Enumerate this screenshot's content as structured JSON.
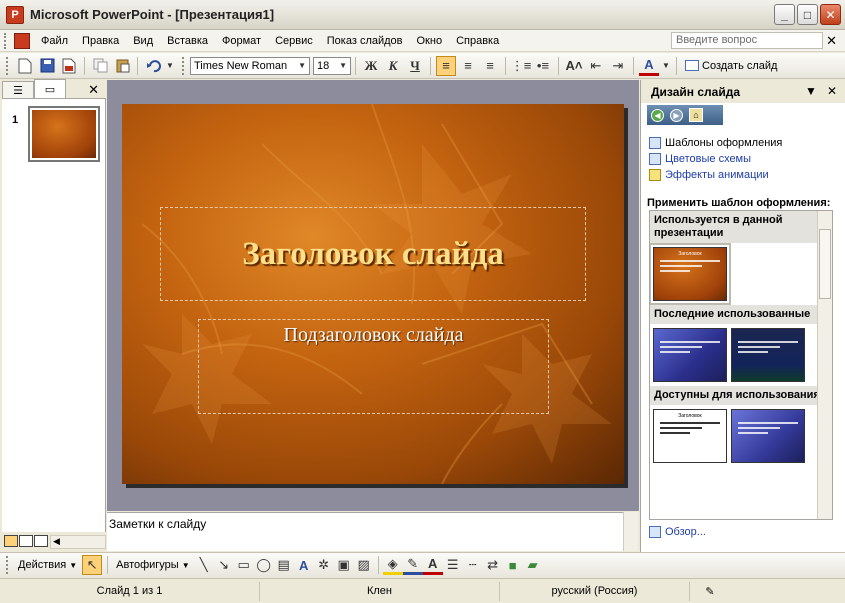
{
  "window": {
    "title": "Microsoft PowerPoint - [Презентация1]",
    "min_glyph": "_",
    "max_glyph": "□",
    "close_glyph": "✕"
  },
  "menu": {
    "items": [
      "Файл",
      "Правка",
      "Вид",
      "Вставка",
      "Формат",
      "Сервис",
      "Показ слайдов",
      "Окно",
      "Справка"
    ],
    "help_placeholder": "Введите вопрос",
    "close_glyph": "✕"
  },
  "toolbar": {
    "font_name": "Times New Roman",
    "font_size": "18",
    "bold": "Ж",
    "italic": "К",
    "underline": "Ч",
    "new_slide": "Создать слайд"
  },
  "left_pane": {
    "slide_number": "1",
    "close_glyph": "✕"
  },
  "slide": {
    "title": "Заголовок слайда",
    "subtitle": "Подзаголовок слайда"
  },
  "notes": {
    "placeholder": "Заметки к слайду"
  },
  "task_pane": {
    "title": "Дизайн слайда",
    "links": [
      {
        "label": "Шаблоны оформления",
        "icon": "template-icon"
      },
      {
        "label": "Цветовые схемы",
        "icon": "color-scheme-icon"
      },
      {
        "label": "Эффекты анимации",
        "icon": "star-icon"
      }
    ],
    "apply_label": "Применить шаблон оформления:",
    "sections": [
      {
        "label": "Используется в данной презентации"
      },
      {
        "label": "Последние использованные"
      },
      {
        "label": "Доступны для использования"
      }
    ],
    "thumb_title": "Заголовок",
    "browse": "Обзор..."
  },
  "draw_toolbar": {
    "actions": "Действия",
    "autoshapes": "Автофигуры"
  },
  "status": {
    "slide": "Слайд 1 из 1",
    "design": "Клен",
    "language": "русский (Россия)"
  },
  "colors": {
    "slide_orange": "#c46410",
    "title_gold": "#ffdf8a",
    "link_blue": "#1f3ea8"
  }
}
